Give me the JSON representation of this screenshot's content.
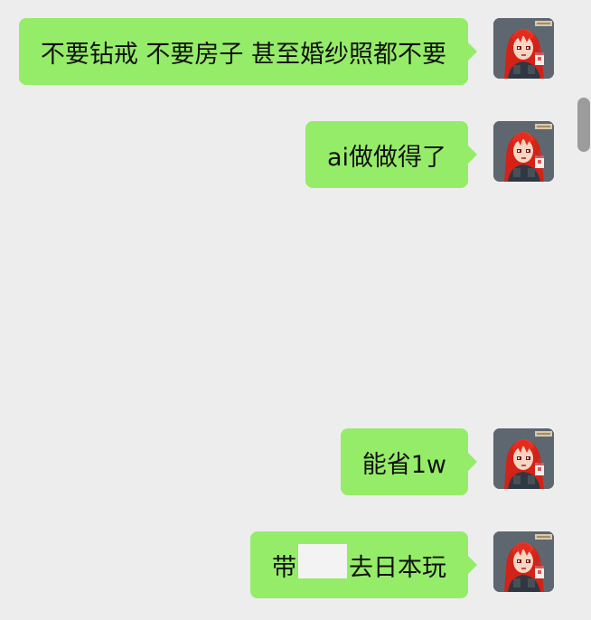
{
  "messages": [
    {
      "text": "不要钻戒 不要房子 甚至婚纱照都不要"
    },
    {
      "text": "ai做做得了"
    },
    {
      "text": "能省1w"
    },
    {
      "text_before": "带",
      "text_after": "去日本玩",
      "redacted": true
    }
  ],
  "colors": {
    "background": "#EDEDED",
    "bubble": "#95EC69",
    "text": "#111111",
    "redaction": "#F3F3F3",
    "scrollbar": "#9C9C9C"
  },
  "avatar_icon": "red-haired-anime-girl-avatar-icon"
}
